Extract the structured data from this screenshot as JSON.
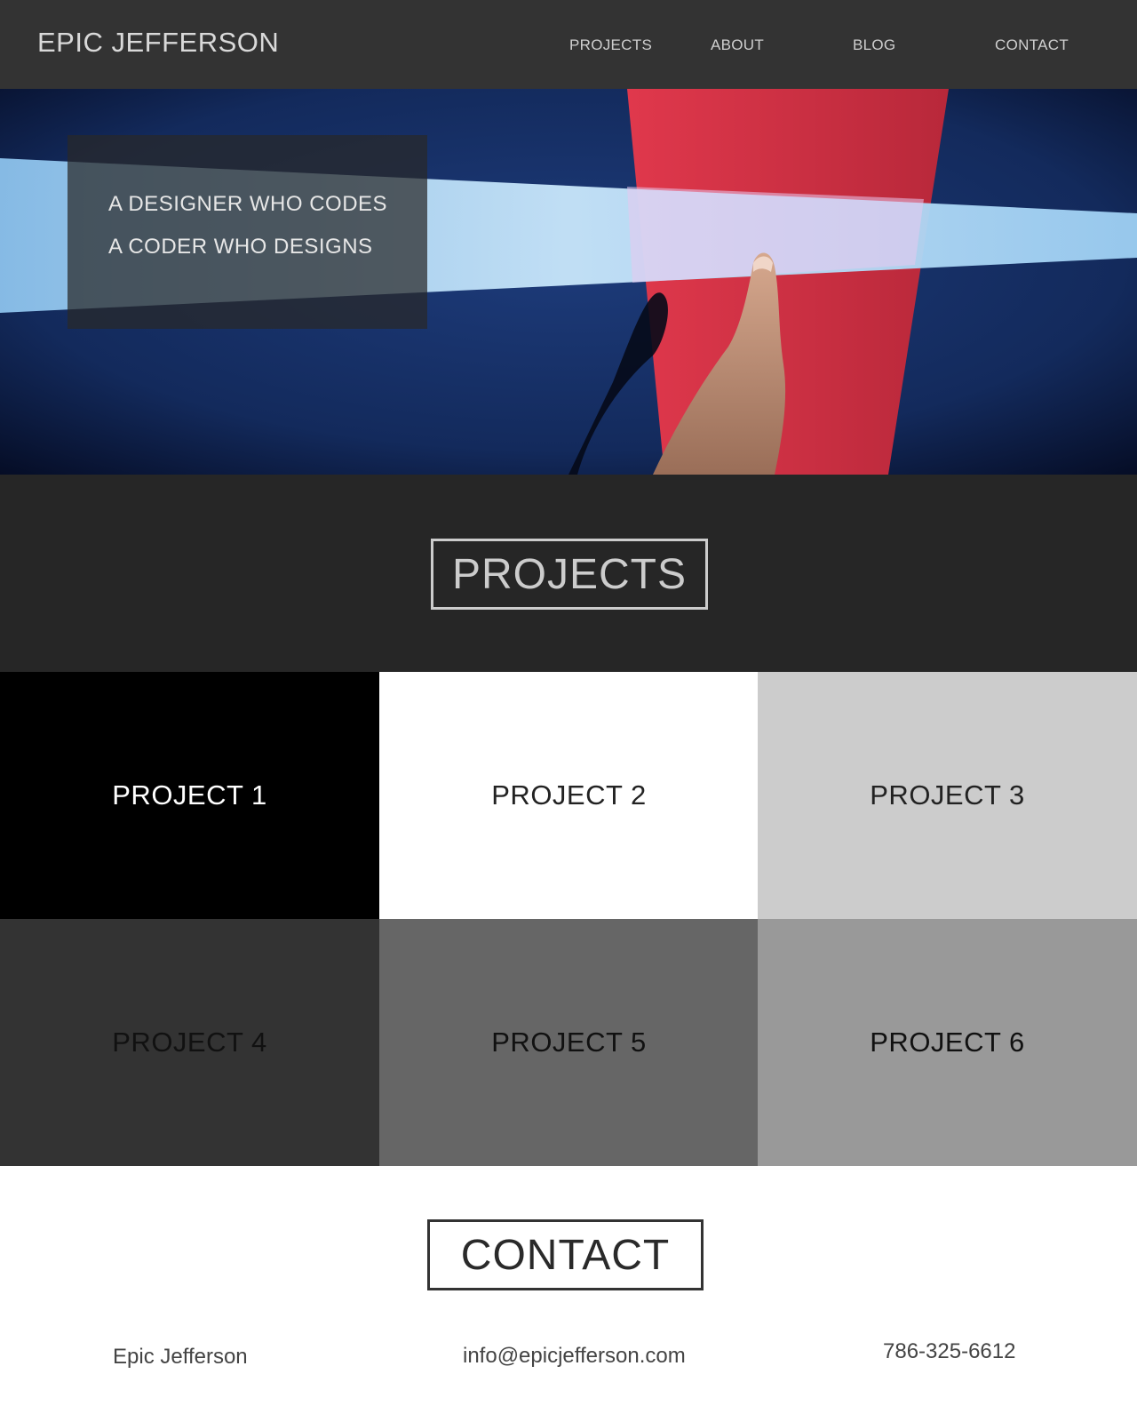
{
  "header": {
    "brand": "EPIC JEFFERSON",
    "nav": [
      "PROJECTS",
      "ABOUT",
      "BLOG",
      "CONTACT"
    ]
  },
  "hero": {
    "line1": "A DESIGNER WHO CODES",
    "line2": "A CODER WHO DESIGNS"
  },
  "projects": {
    "title": "PROJECTS",
    "tiles": [
      {
        "label": "PROJECT 1",
        "bg": "#000000",
        "fg": "#ffffff"
      },
      {
        "label": "PROJECT 2",
        "bg": "#ffffff",
        "fg": "#222222"
      },
      {
        "label": "PROJECT 3",
        "bg": "#cccccc",
        "fg": "#222222"
      },
      {
        "label": "PROJECT 4",
        "bg": "#333333",
        "fg": "#111111"
      },
      {
        "label": "PROJECT 5",
        "bg": "#666666",
        "fg": "#111111"
      },
      {
        "label": "PROJECT 6",
        "bg": "#999999",
        "fg": "#111111"
      }
    ]
  },
  "contact": {
    "title": "CONTACT",
    "name": "Epic Jefferson",
    "email": "info@epicjefferson.com",
    "phone": "786-325-6612"
  }
}
